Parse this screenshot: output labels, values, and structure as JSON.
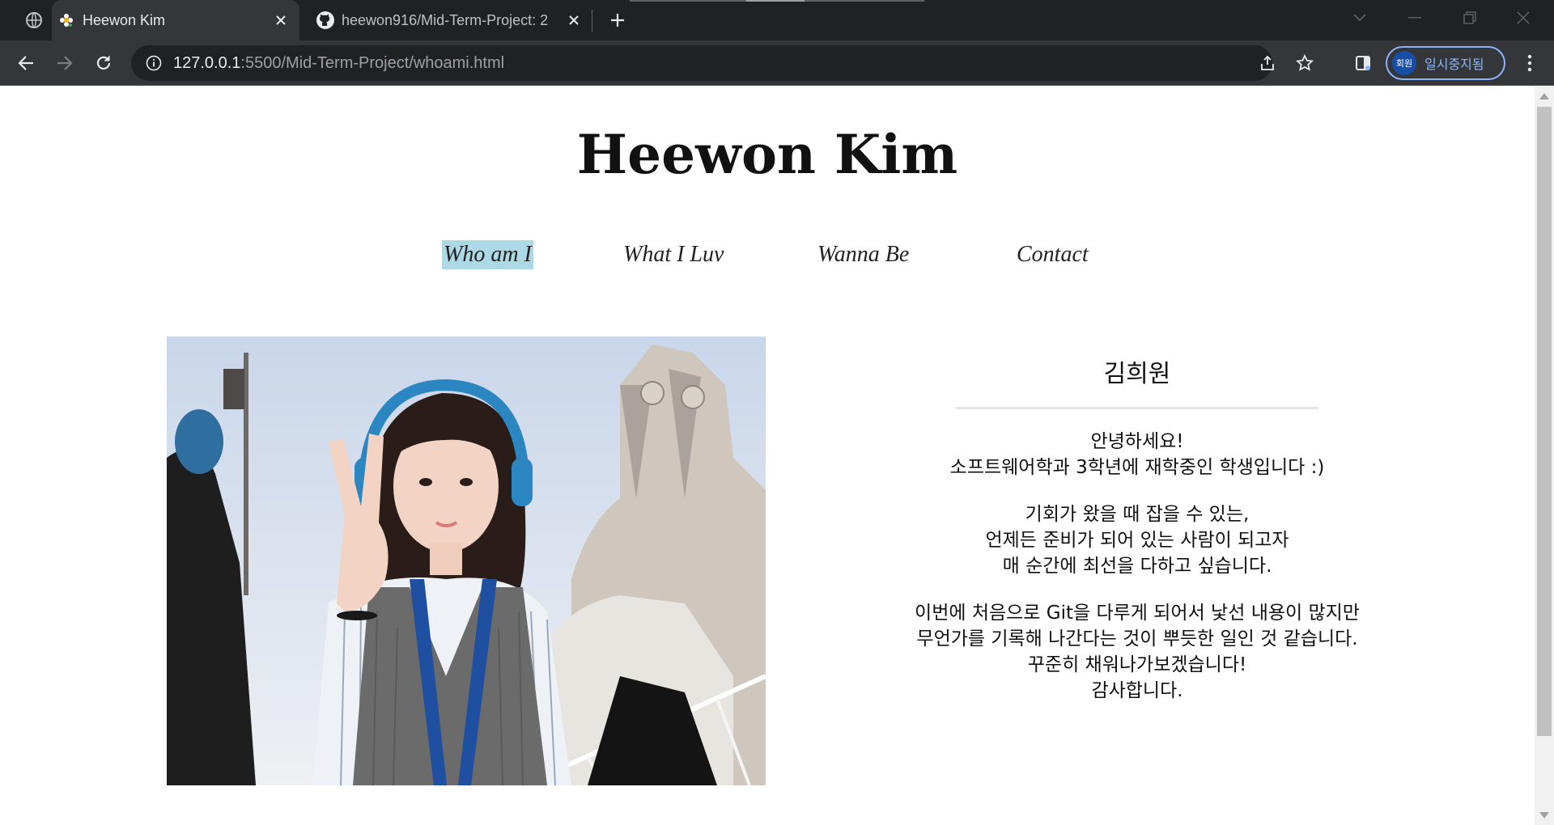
{
  "browser": {
    "tabs": [
      {
        "title": "Heewon Kim",
        "active": true,
        "icon": "flower-favicon"
      },
      {
        "title": "heewon916/Mid-Term-Project: 2",
        "active": false,
        "icon": "github-icon"
      }
    ],
    "address": {
      "host": "127.0.0.1",
      "path": ":5500/Mid-Term-Project/whoami.html"
    },
    "profile": {
      "avatar_text": "회원",
      "status": "일시중지됨"
    }
  },
  "page": {
    "title": "Heewon Kim",
    "nav": [
      {
        "label": "Who am I",
        "current": true
      },
      {
        "label": "What I Luv",
        "current": false
      },
      {
        "label": "Wanna Be",
        "current": false
      },
      {
        "label": "Contact",
        "current": false
      }
    ],
    "photo_alt": "selfie photo",
    "name": "김희원",
    "para1": [
      "안녕하세요!",
      "소프트웨어학과 3학년에 재학중인 학생입니다 :)"
    ],
    "para2": [
      "기회가 왔을 때 잡을 수 있는,",
      "언제든 준비가 되어 있는 사람이 되고자",
      "매 순간에 최선을 다하고 싶습니다."
    ],
    "para3": [
      "이번에 처음으로 Git을 다루게 되어서 낯선 내용이 많지만",
      "무언가를 기록해 나간다는 것이 뿌듯한 일인 것 같습니다.",
      "꾸준히 채워나가보겠습니다!",
      "감사합니다."
    ]
  },
  "colors": {
    "nav_highlight": "#add8e6",
    "chrome_dark": "#202124",
    "chrome_toolbar": "#35363a"
  }
}
